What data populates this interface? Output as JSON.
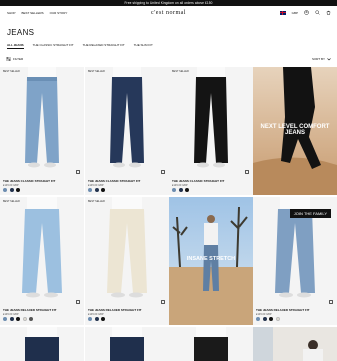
{
  "promo_bar": "Free shipping to United Kingdom on all orders above £150",
  "header": {
    "nav": [
      "SHOP",
      "BEST SELLERS",
      "OUR STORY"
    ],
    "logo": "c'est normal",
    "currency": "GBP"
  },
  "page_title": "JEANS",
  "tabs": [
    "ALL JEANS",
    "THE CLASSIC STRAIGHT FIT",
    "THE RELAXED STRAIGHT FIT",
    "THE SLIM FIT"
  ],
  "toolbar": {
    "filter_label": "FILTER",
    "sort_label": "SORT BY"
  },
  "products": [
    {
      "badge": "BEST SELLER",
      "name": "THE JEANS CLASSIC STRAIGHT FIT",
      "price": "£145.00 GBP",
      "swatches": [
        "#6d8db0",
        "#22324d",
        "#111111"
      ]
    },
    {
      "badge": "BEST SELLER",
      "name": "THE JEANS CLASSIC STRAIGHT FIT",
      "price": "£145.00 GBP",
      "swatches": [
        "#6d8db0",
        "#22324d",
        "#111111"
      ]
    },
    {
      "badge": "BEST SELLER",
      "name": "THE JEANS CLASSIC STRAIGHT FIT",
      "price": "£145.00 GBP",
      "swatches": [
        "#6d8db0",
        "#22324d",
        "#111111"
      ]
    },
    {
      "badge": "BEST SELLER",
      "name": "THE JEANS RELAXED STRAIGHT FIT",
      "price": "£145.00 GBP",
      "swatches": [
        "#6d8db0",
        "#22324d",
        "#111111",
        "#e8e2d4",
        "#555555"
      ]
    },
    {
      "badge": "BEST SELLER",
      "name": "THE JEANS RELAXED STRAIGHT FIT",
      "price": "£145.00 GBP",
      "swatches": [
        "#6d8db0",
        "#22324d",
        "#111111"
      ]
    },
    {
      "badge": "",
      "name": "THE JEANS RELAXED STRAIGHT FIT",
      "price": "£145.00 GBP",
      "swatches": [
        "#6d8db0",
        "#22324d",
        "#111111",
        "#e8e2d4"
      ]
    }
  ],
  "promo_tiles": [
    "NEXT LEVEL COMFORT JEANS",
    "INSANE STRETCH"
  ],
  "join_button": "JOIN THE FAMILY"
}
